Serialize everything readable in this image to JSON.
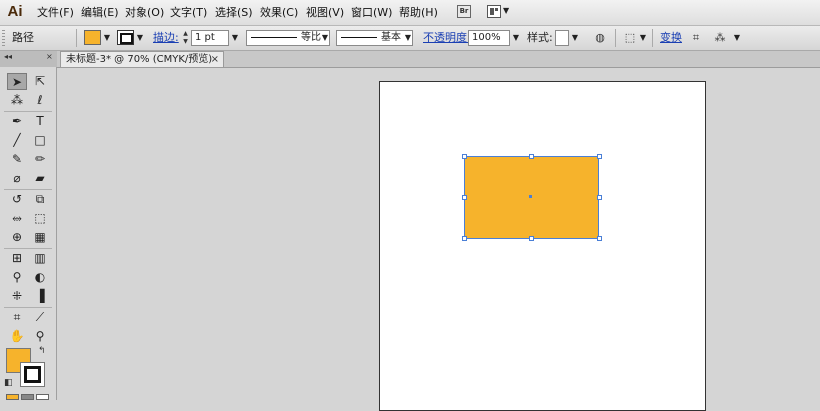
{
  "app": {
    "logo": "Ai"
  },
  "menu": [
    {
      "label": "文件(F)"
    },
    {
      "label": "编辑(E)"
    },
    {
      "label": "对象(O)"
    },
    {
      "label": "文字(T)"
    },
    {
      "label": "选择(S)"
    },
    {
      "label": "效果(C)"
    },
    {
      "label": "视图(V)"
    },
    {
      "label": "窗口(W)"
    },
    {
      "label": "帮助(H)"
    }
  ],
  "menu_icons": {
    "bridge": "Br",
    "arrange": "arrange-documents-icon"
  },
  "control": {
    "selection_label": "路径",
    "stroke_link": "描边:",
    "stroke_weight": "1 pt",
    "profile_label": "等比",
    "brush_label": "基本",
    "opacity_link": "不透明度:",
    "opacity_value": "100%",
    "style_label": "样式:",
    "transform_link": "变换"
  },
  "colors": {
    "fill": "#f6b32c",
    "stroke": "#ffffff",
    "selection": "#4a7fd6"
  },
  "document": {
    "tab_title": "未标题-3* @ 70% (CMYK/预览)",
    "close": "×"
  },
  "tools_panel": {
    "collapse": "◂◂",
    "close": "×"
  }
}
